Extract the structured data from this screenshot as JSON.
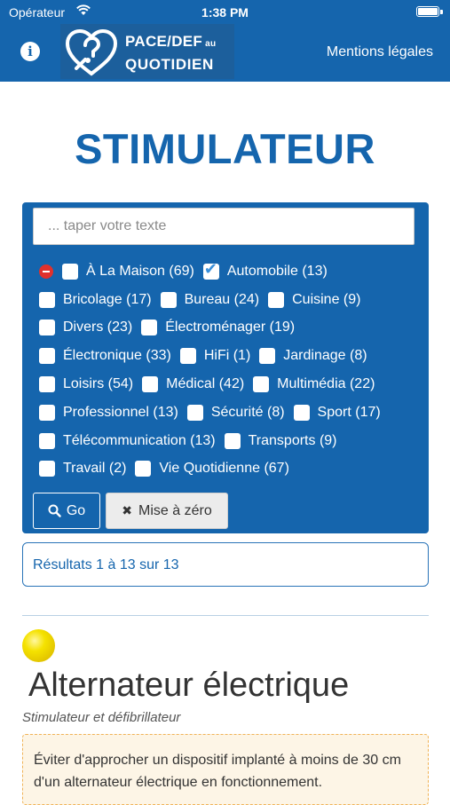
{
  "status_bar": {
    "carrier": "Opérateur",
    "time": "1:38 PM"
  },
  "navbar": {
    "info_icon": "info-icon",
    "logo_line1": "PACE/DEF",
    "logo_au": "au",
    "logo_line2": "QUOTIDIEN",
    "mentions": "Mentions légales",
    "color": "#1565ad"
  },
  "page_title": "STIMULATEUR",
  "search": {
    "placeholder": "... taper votre texte",
    "value": ""
  },
  "filters": {
    "rows": [
      [
        {
          "label": "À La Maison (69)",
          "checked": false
        },
        {
          "label": "Automobile (13)",
          "checked": true
        }
      ],
      [
        {
          "label": "Bricolage (17)",
          "checked": false
        },
        {
          "label": "Bureau (24)",
          "checked": false
        },
        {
          "label": "Cuisine (9)",
          "checked": false
        }
      ],
      [
        {
          "label": "Divers (23)",
          "checked": false
        },
        {
          "label": "Électroménager (19)",
          "checked": false
        }
      ],
      [
        {
          "label": "Électronique (33)",
          "checked": false
        },
        {
          "label": "HiFi (1)",
          "checked": false
        },
        {
          "label": "Jardinage (8)",
          "checked": false
        }
      ],
      [
        {
          "label": "Loisirs (54)",
          "checked": false
        },
        {
          "label": "Médical (42)",
          "checked": false
        },
        {
          "label": "Multimédia (22)",
          "checked": false
        }
      ],
      [
        {
          "label": "Professionnel (13)",
          "checked": false
        },
        {
          "label": "Sécurité (8)",
          "checked": false
        },
        {
          "label": "Sport (17)",
          "checked": false
        }
      ],
      [
        {
          "label": "Télécommunication (13)",
          "checked": false
        },
        {
          "label": "Transports (9)",
          "checked": false
        }
      ],
      [
        {
          "label": "Travail (2)",
          "checked": false
        },
        {
          "label": "Vie Quotidienne (67)",
          "checked": false
        }
      ]
    ]
  },
  "buttons": {
    "go": "Go",
    "reset": "Mise à zéro"
  },
  "results": {
    "text": "Résultats 1 à 13 sur 13"
  },
  "item": {
    "indicator_color": "#f5e200",
    "title": "Alternateur électrique",
    "subtitle": "Stimulateur et défibrillateur",
    "warning": "Éviter d'approcher un dispositif implanté à moins de 30 cm d'un alternateur électrique en fonctionnement."
  }
}
